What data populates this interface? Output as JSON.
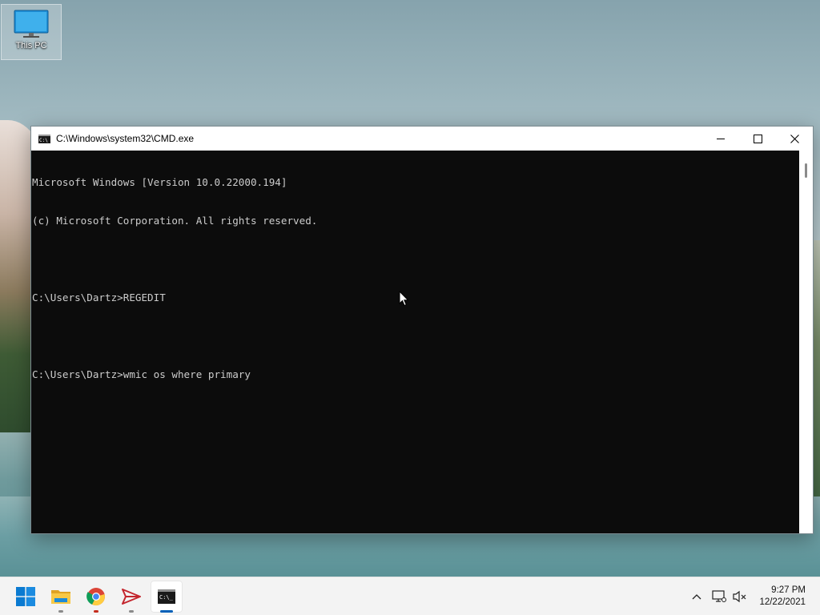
{
  "desktop": {
    "icons": [
      {
        "label": "This PC",
        "icon": "monitor-icon"
      }
    ]
  },
  "window": {
    "title": "C:\\Windows\\system32\\CMD.exe",
    "controls": {
      "minimize": "minimize-icon",
      "maximize": "maximize-icon",
      "close": "close-icon"
    },
    "console_lines": [
      "Microsoft Windows [Version 10.0.22000.194]",
      "(c) Microsoft Corporation. All rights reserved.",
      "",
      "C:\\Users\\Dartz>REGEDIT",
      "",
      "C:\\Users\\Dartz>wmic os where primary"
    ]
  },
  "taskbar": {
    "apps": [
      {
        "name": "start",
        "icon": "windows-logo-icon"
      },
      {
        "name": "file-explorer",
        "icon": "folder-icon"
      },
      {
        "name": "chrome",
        "icon": "chrome-icon"
      },
      {
        "name": "send-app",
        "icon": "paper-plane-icon"
      },
      {
        "name": "command-prompt",
        "icon": "terminal-icon",
        "active": true
      }
    ],
    "tray": {
      "chevron": "chevron-up-icon",
      "network": "network-icon",
      "volume": "volume-muted-icon"
    },
    "clock": {
      "time": "9:27 PM",
      "date": "12/22/2021"
    }
  },
  "colors": {
    "console_bg": "#0c0c0c",
    "console_fg": "#cccccc",
    "accent": "#0078d4"
  }
}
